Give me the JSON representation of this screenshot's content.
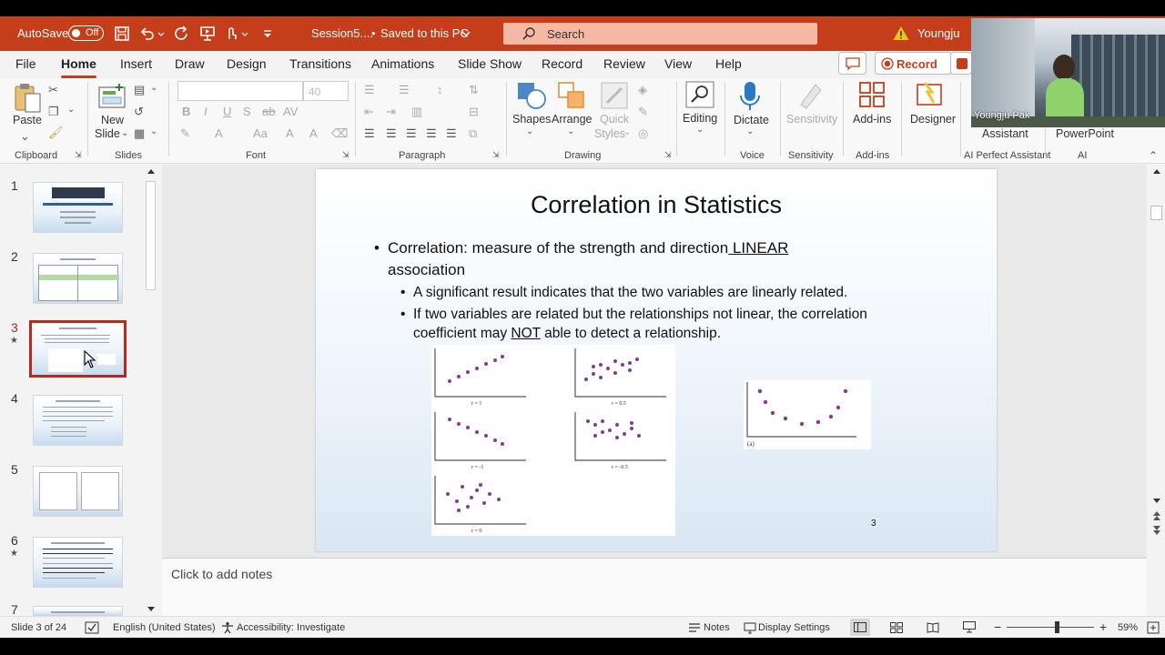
{
  "titlebar": {
    "autosave_label": "AutoSave",
    "autosave_state": "Off",
    "doc_title": "Session5....",
    "saved_status": "Saved to this PC",
    "search_placeholder": "Search",
    "user_name": "Youngju"
  },
  "menu": {
    "tabs": [
      "File",
      "Home",
      "Insert",
      "Draw",
      "Design",
      "Transitions",
      "Animations",
      "Slide Show",
      "Record",
      "Review",
      "View",
      "Help"
    ],
    "active": "Home",
    "record_button": "Record"
  },
  "ribbon": {
    "clipboard": {
      "label": "Clipboard",
      "paste": "Paste"
    },
    "slides": {
      "label": "Slides",
      "new_slide_1": "New",
      "new_slide_2": "Slide"
    },
    "font": {
      "label": "Font",
      "size": "40"
    },
    "paragraph": {
      "label": "Paragraph"
    },
    "drawing": {
      "label": "Drawing",
      "shapes": "Shapes",
      "arrange": "Arrange",
      "quick_styles_1": "Quick",
      "quick_styles_2": "Styles"
    },
    "editing": {
      "label": "Editing"
    },
    "voice": {
      "label": "Voice",
      "dictate": "Dictate"
    },
    "sensitivity": {
      "label": "Sensitivity",
      "button": "Sensitivity"
    },
    "addins": {
      "label": "Add-ins",
      "button": "Add-ins"
    },
    "designer": {
      "button": "Designer"
    },
    "ai_perfect": {
      "label": "AI Perfect Assistant",
      "button": "Assistant"
    },
    "ai": {
      "label": "AI",
      "button": "PowerPoint"
    }
  },
  "thumbnails": [
    {
      "num": "1",
      "title": "Correlations & Linear Regression Models",
      "starred": false
    },
    {
      "num": "2",
      "title": "Choosing a statistical test",
      "starred": false
    },
    {
      "num": "3",
      "title": "Correlation in Statistics",
      "starred": true
    },
    {
      "num": "4",
      "title": "Pearson's correlation coefficient (r)",
      "starred": false
    },
    {
      "num": "5",
      "title": "",
      "starred": false
    },
    {
      "num": "6",
      "title": "Caveats of the correlation coefficient",
      "starred": true
    },
    {
      "num": "7",
      "title": "Simple Linear Regression Models",
      "starred": false
    }
  ],
  "slide": {
    "title": "Correlation in Statistics",
    "bullet1_a": "Correlation: measure of the strength and direction",
    "bullet1_b": " LINEAR",
    "bullet1_c": "association",
    "sub1": "A significant result indicates that the two variables are linearly related.",
    "sub2_a": "If two variables are related but the relationships not linear, the correlation",
    "sub2_b": "coefficient may ",
    "sub2_c": "NOT",
    "sub2_d": " able to detect a relationship.",
    "plot_labels": [
      "r = 1",
      "r = 0.5",
      "r = -1",
      "r = -0.5",
      "r = 0"
    ],
    "u_plot_label": "(a)",
    "page_number": "3"
  },
  "notes_placeholder": "Click to add notes",
  "status": {
    "slide_info": "Slide 3 of 24",
    "language": "English (United States)",
    "accessibility": "Accessibility: Investigate",
    "notes": "Notes",
    "display_settings": "Display Settings",
    "zoom": "59%",
    "zoom_fraction": 0.59
  },
  "webcam": {
    "name": "Youngju Pak"
  },
  "colors": {
    "accent": "#c43e1c",
    "selection": "#b32a1f",
    "dots": "#8b3a8f"
  }
}
